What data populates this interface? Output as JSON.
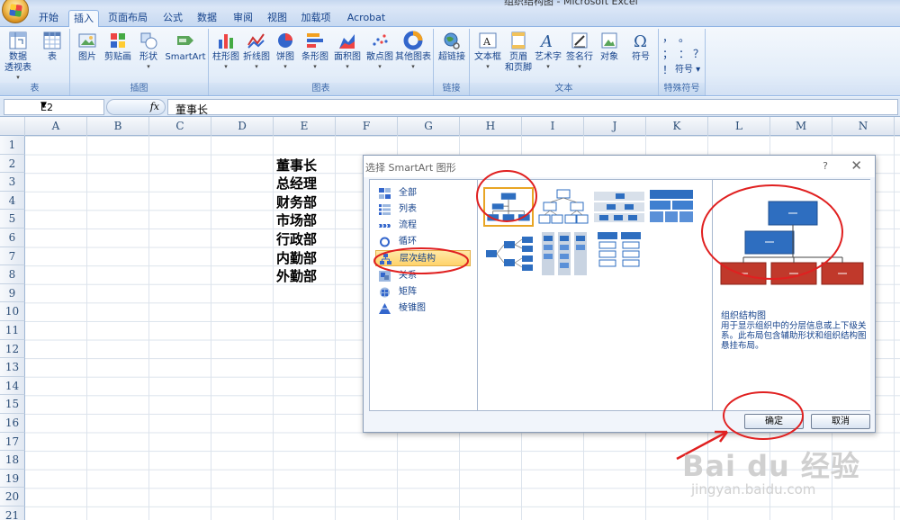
{
  "window": {
    "title": "组织结构图 - Microsoft Excel"
  },
  "tabs": [
    {
      "label": "开始"
    },
    {
      "label": "插入",
      "active": true
    },
    {
      "label": "页面布局"
    },
    {
      "label": "公式"
    },
    {
      "label": "数据"
    },
    {
      "label": "审阅"
    },
    {
      "label": "视图"
    },
    {
      "label": "加载项"
    },
    {
      "label": "Acrobat"
    }
  ],
  "ribbon": {
    "groups": {
      "table": "表",
      "illustrations": "插图",
      "charts": "图表",
      "links": "链接",
      "text": "文本",
      "symbols": "特殊符号"
    },
    "buttons": {
      "pivot_line1": "数据",
      "pivot_line2": "透视表",
      "table": "表",
      "picture": "图片",
      "clipart": "剪贴画",
      "shapes": "形状",
      "smartart": "SmartArt",
      "column": "柱形图",
      "line": "折线图",
      "pie": "饼图",
      "bar": "条形图",
      "area": "面积图",
      "scatter": "散点图",
      "other_charts": "其他图表",
      "hyperlink": "超链接",
      "textbox": "文本框",
      "header_line1": "页眉",
      "header_line2": "和页脚",
      "wordart": "艺术字",
      "signature": "签名行",
      "object": "对象",
      "symbol": "符号",
      "symbol_dd": "符号",
      "sym1": "，",
      "sym2": "。",
      "sym3": "；",
      "sym4": "：",
      "sym5": "？",
      "sym6": "！"
    }
  },
  "formula_bar": {
    "name_box": "E2",
    "fx": "fx",
    "content": "董事长"
  },
  "grid": {
    "columns": [
      "A",
      "B",
      "C",
      "D",
      "E",
      "F",
      "G",
      "H",
      "I",
      "J",
      "K",
      "L",
      "M",
      "N"
    ],
    "rows": [
      "1",
      "2",
      "3",
      "4",
      "5",
      "6",
      "7",
      "8",
      "9",
      "10",
      "11",
      "12",
      "13",
      "14",
      "15",
      "16",
      "17",
      "18",
      "19",
      "20",
      "21"
    ],
    "cells_e": [
      "董事长",
      "总经理",
      "财务部",
      "市场部",
      "行政部",
      "内勤部",
      "外勤部"
    ]
  },
  "dialog": {
    "title": "选择 SmartArt 图形",
    "help": "?",
    "close": "✕",
    "categories": [
      {
        "label": "全部"
      },
      {
        "label": "列表"
      },
      {
        "label": "流程"
      },
      {
        "label": "循环"
      },
      {
        "label": "层次结构",
        "selected": true
      },
      {
        "label": "关系"
      },
      {
        "label": "矩阵"
      },
      {
        "label": "棱锥图"
      }
    ],
    "preview_title": "组织结构图",
    "preview_desc": "用于显示组织中的分层信息或上下级关系。此布局包含辅助形状和组织结构图悬挂布局。",
    "ok": "确定",
    "cancel": "取消"
  },
  "watermark": {
    "brand": "Bai du 经验",
    "url": "jingyan.baidu.com"
  },
  "colors": {
    "accent_red": "#e02020",
    "ribbon_blue": "#15428b",
    "selected_cat": "#ffd36b",
    "node_blue": "#2e6ec0",
    "node_red": "#c0392b"
  }
}
